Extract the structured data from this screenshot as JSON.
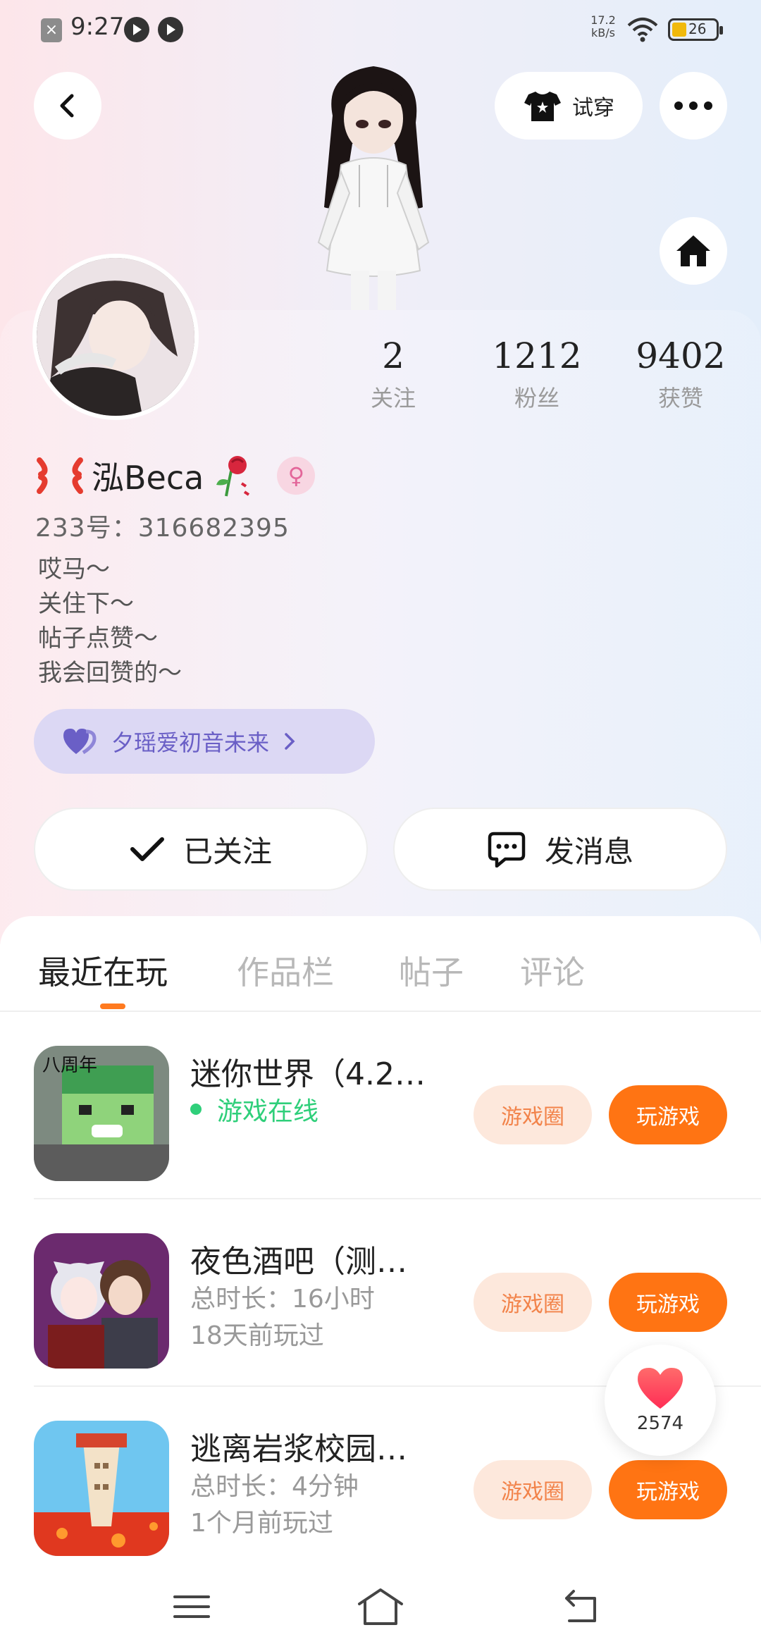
{
  "status_bar": {
    "time": "9:27",
    "net_speed_value": "17.2",
    "net_speed_unit": "kB/s",
    "battery": "26",
    "battery_color": "#f0b90b"
  },
  "header": {
    "tryon_label": "试穿",
    "back_icon": "chevron-left-icon",
    "more_icon": "more-icon",
    "home_icon": "home-icon"
  },
  "profile": {
    "name": "泓Beca",
    "gender_symbol": "♀",
    "uid": "233号：316682395",
    "bio": [
      "哎马～",
      "关住下～",
      "帖子点赞～",
      "我会回赞的～"
    ],
    "club_label": "夕瑶爱初音未来",
    "stats": [
      {
        "value": "2",
        "label": "关注"
      },
      {
        "value": "1212",
        "label": "粉丝"
      },
      {
        "value": "9402",
        "label": "获赞"
      }
    ]
  },
  "actions": {
    "follow_label": "已关注",
    "message_label": "发消息"
  },
  "tabs": [
    {
      "label": "最近在玩",
      "active": true
    },
    {
      "label": "作品栏",
      "active": false
    },
    {
      "label": "帖子",
      "active": false
    },
    {
      "label": "评论",
      "active": false
    }
  ],
  "games": [
    {
      "title": "迷你世界（4.2…",
      "status": "游戏在线",
      "circle_label": "游戏圈",
      "play_label": "玩游戏"
    },
    {
      "title": "夜色酒吧（测…",
      "duration": "总时长：16小时",
      "last_played": "18天前玩过",
      "circle_label": "游戏圈",
      "play_label": "玩游戏"
    },
    {
      "title": "逃离岩浆校园…",
      "duration": "总时长：4分钟",
      "last_played": "1个月前玩过",
      "circle_label": "游戏圈",
      "play_label": "玩游戏"
    }
  ],
  "like_float": {
    "count": "2574"
  },
  "colors": {
    "accent": "#ff7413",
    "online": "#2fcf7a",
    "club_bg": "#dcd8f4",
    "club_text": "#6a5fc6"
  }
}
